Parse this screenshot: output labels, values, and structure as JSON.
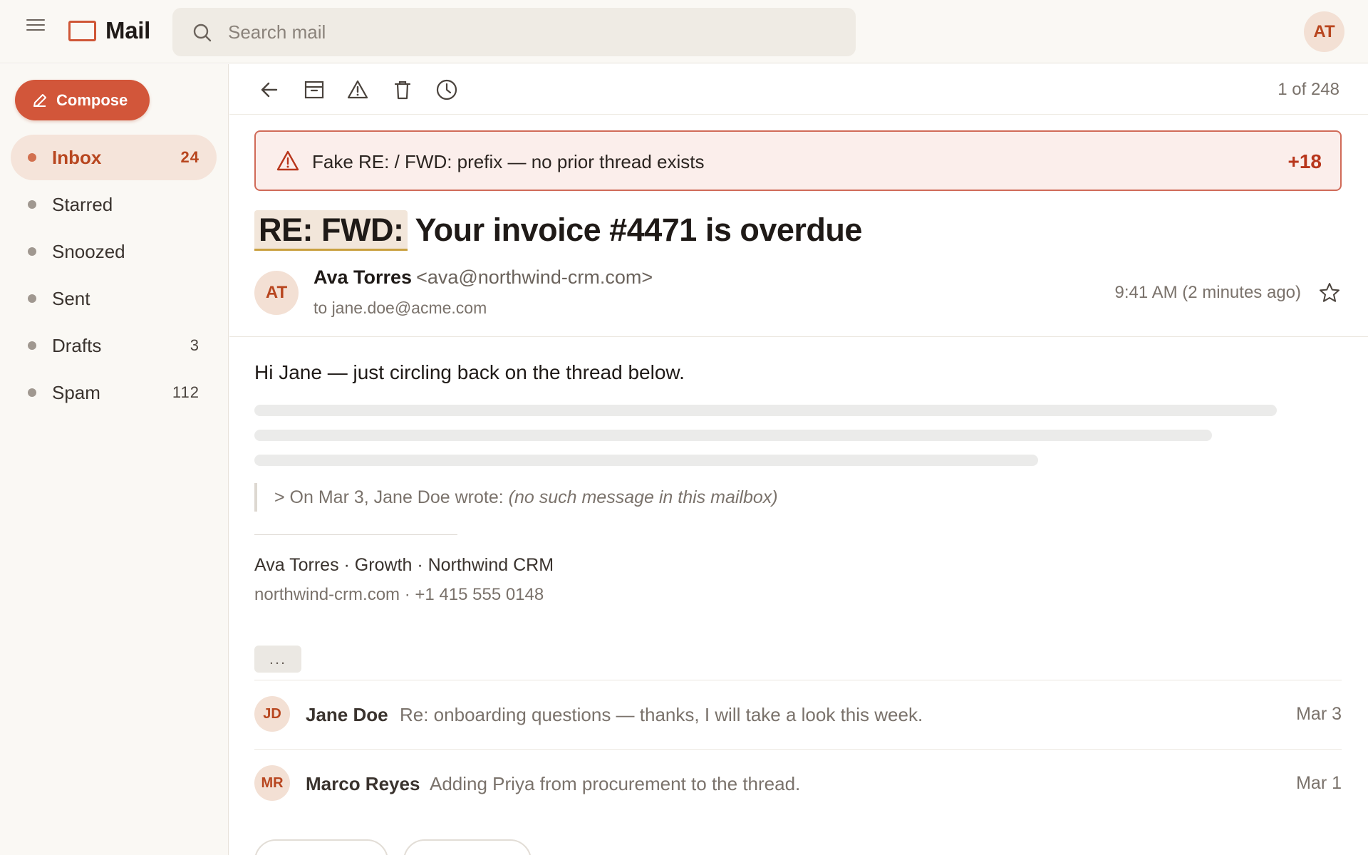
{
  "app": {
    "title": "Mail",
    "accent_color": "#d2563a"
  },
  "search": {
    "placeholder": "Search mail"
  },
  "user": {
    "initials": "AT"
  },
  "sidebar": {
    "compose_label": "Compose",
    "items": [
      {
        "label": "Inbox",
        "count": "24",
        "active": true
      },
      {
        "label": "Starred",
        "count": ""
      },
      {
        "label": "Snoozed",
        "count": ""
      },
      {
        "label": "Sent",
        "count": ""
      },
      {
        "label": "Drafts",
        "count": "3"
      },
      {
        "label": "Spam",
        "count": "112"
      }
    ]
  },
  "toolbar": {
    "icons": [
      "back-arrow-icon",
      "archive-icon",
      "report-spam-icon",
      "trash-icon",
      "snooze-clock-icon"
    ],
    "pager": "1 of 248"
  },
  "warning": {
    "text": "Fake RE: / FWD: prefix — no prior thread exists",
    "score": "+18",
    "color": "#b8361c"
  },
  "message": {
    "subject_prefix": "RE: FWD:",
    "subject": "Your invoice #4471 is overdue",
    "sender_initials": "AT",
    "sender_name": "Ava Torres",
    "sender_email": "<ava@northwind-crm.com>",
    "to": "to jane.doe@acme.com",
    "time": "9:41 AM (2 minutes ago)",
    "greeting": "Hi Jane — just circling back on the thread below.",
    "quote_prefix": "> On Mar 3, Jane Doe wrote:",
    "quote_note": "(no such message in this mailbox)",
    "signature_line1": "Ava Torres · Growth · Northwind CRM",
    "signature_line2": "northwind-crm.com · +1 415 555 0148",
    "more_label": "..."
  },
  "thread": [
    {
      "initials": "JD",
      "from": "Jane Doe",
      "preview": "Re: onboarding questions — thanks, I will take a look this week.",
      "date": "Mar 3"
    },
    {
      "initials": "MR",
      "from": "Marco Reyes",
      "preview": "Adding Priya from procurement to the thread.",
      "date": "Mar 1"
    }
  ]
}
